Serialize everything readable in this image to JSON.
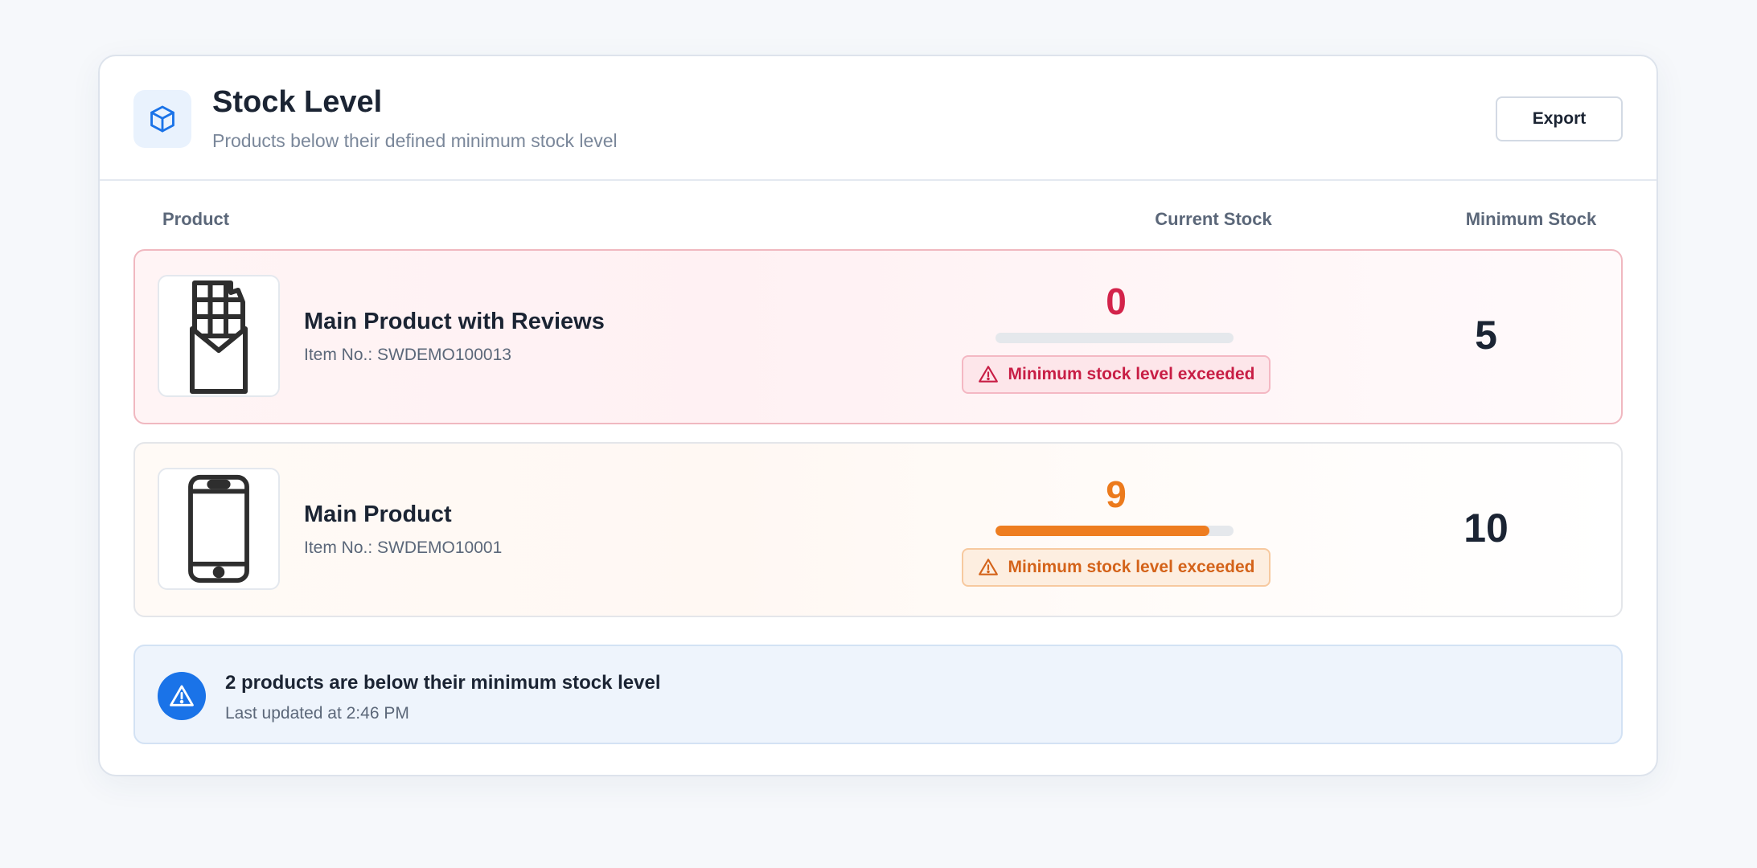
{
  "header": {
    "title": "Stock Level",
    "subtitle": "Products below their defined minimum stock level",
    "export_label": "Export",
    "icon": "box-icon"
  },
  "columns": {
    "product": "Product",
    "current_stock": "Current Stock",
    "minimum_stock": "Minimum Stock"
  },
  "products": [
    {
      "name": "Main Product with Reviews",
      "item_no": "Item No.: SWDEMO100013",
      "current_stock": "0",
      "minimum_stock": "5",
      "stock_fraction": 0,
      "warning": "Minimum stock level exceeded",
      "status_color": "#d3234a",
      "icon": "chocolate-bar-icon"
    },
    {
      "name": "Main Product",
      "item_no": "Item No.: SWDEMO10001",
      "current_stock": "9",
      "minimum_stock": "10",
      "stock_fraction": 0.9,
      "warning": "Minimum stock level exceeded",
      "status_color": "#ec7a1c",
      "icon": "smartphone-icon"
    }
  ],
  "summary": {
    "title": "2 products are below their minimum stock level",
    "updated": "Last updated at 2:46 PM",
    "icon": "warning-icon"
  },
  "colors": {
    "accent": "#1a73e8",
    "danger": "#d3234a",
    "warning": "#ec7a1c"
  }
}
